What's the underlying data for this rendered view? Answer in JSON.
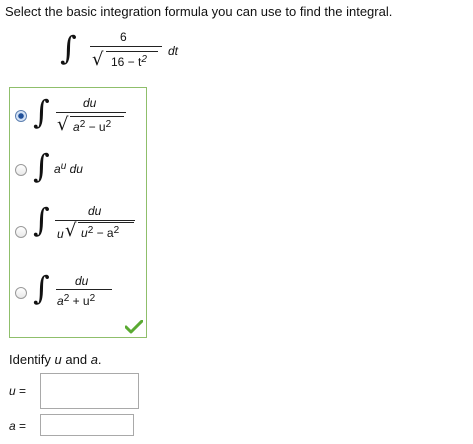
{
  "prompt": "Select the basic integration formula you can use to find the integral.",
  "problem": {
    "numerator": "6",
    "radicand": "16 − t",
    "radicand_exp": "2",
    "differential": "dt"
  },
  "options": [
    {
      "numerator": "du",
      "radicand_a": "a",
      "radicand_a_exp": "2",
      "radicand_mid": " − u",
      "radicand_u_exp": "2",
      "selected": true
    },
    {
      "base": "a",
      "base_exp": "u",
      "tail": " du",
      "selected": false
    },
    {
      "numerator": "du",
      "prefix": "u",
      "radicand_u": "u",
      "radicand_u_exp": "2",
      "radicand_mid": " − a",
      "radicand_a_exp": "2",
      "selected": false
    },
    {
      "numerator": "du",
      "den_a": "a",
      "den_a_exp": "2",
      "den_mid": " + u",
      "den_u_exp": "2",
      "selected": false
    }
  ],
  "answer_status": "correct",
  "identify": {
    "prefix": "Identify ",
    "u": "u",
    "middle": " and ",
    "a": "a",
    "suffix": "."
  },
  "fields": {
    "u_label": "u",
    "u_eq": " =",
    "u_value": "",
    "a_label": "a",
    "a_eq": " =",
    "a_value": ""
  },
  "colors": {
    "box_border": "#8fbf6b",
    "check": "#5aaa32",
    "radio_selected": "#1f4f99"
  }
}
